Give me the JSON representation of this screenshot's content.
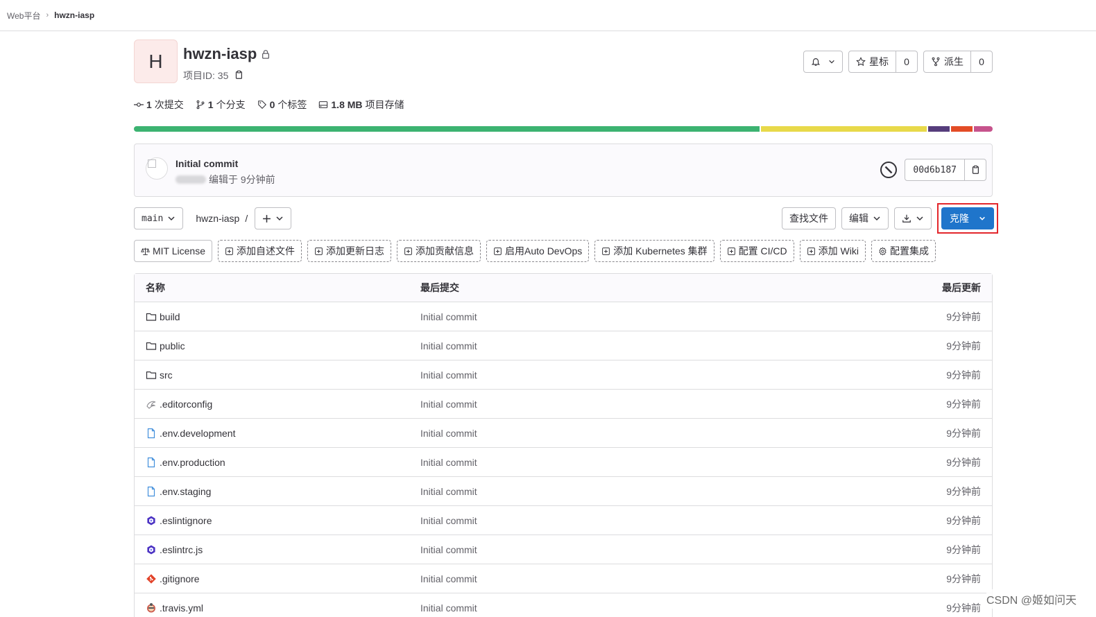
{
  "breadcrumb": {
    "group": "Web平台",
    "project": "hwzn-iasp"
  },
  "project": {
    "avatar_letter": "H",
    "name": "hwzn-iasp",
    "id_label": "项目ID: 35"
  },
  "actions": {
    "star_label": "星标",
    "star_count": "0",
    "fork_label": "派生",
    "fork_count": "0"
  },
  "stats": [
    {
      "icon": "commit-icon",
      "count": "1",
      "label": "次提交"
    },
    {
      "icon": "branch-icon",
      "count": "1",
      "label": "个分支"
    },
    {
      "icon": "tag-icon",
      "count": "0",
      "label": "个标签"
    },
    {
      "icon": "storage-icon",
      "count": "1.8 MB",
      "label": "项目存储"
    }
  ],
  "languages": [
    {
      "color": "#3cb371",
      "share": 0.733
    },
    {
      "color": "#e8d94a",
      "share": 0.195
    },
    {
      "color": "#563d7c",
      "share": 0.025
    },
    {
      "color": "#e34c26",
      "share": 0.025
    },
    {
      "color": "#c6538c",
      "share": 0.022
    }
  ],
  "last_commit": {
    "title": "Initial commit",
    "meta": "编辑于 9分钟前",
    "sha": "00d6b187"
  },
  "toolbar": {
    "branch": "main",
    "path": "hwzn-iasp",
    "path_sep": "/",
    "find_file": "查找文件",
    "edit": "编辑",
    "clone": "克隆"
  },
  "quicklinks": [
    {
      "label": "MIT License",
      "icon": "scale-icon",
      "style": "solid"
    },
    {
      "label": "添加自述文件",
      "icon": "plus-square-icon",
      "style": "dashed"
    },
    {
      "label": "添加更新日志",
      "icon": "plus-square-icon",
      "style": "dashed"
    },
    {
      "label": "添加贡献信息",
      "icon": "plus-square-icon",
      "style": "dashed"
    },
    {
      "label": "启用Auto DevOps",
      "icon": "plus-square-icon",
      "style": "dashed"
    },
    {
      "label": "添加 Kubernetes 集群",
      "icon": "plus-square-icon",
      "style": "dashed"
    },
    {
      "label": "配置 CI/CD",
      "icon": "plus-square-icon",
      "style": "dashed"
    },
    {
      "label": "添加 Wiki",
      "icon": "plus-square-icon",
      "style": "dashed"
    },
    {
      "label": "配置集成",
      "icon": "settings-icon",
      "style": "dashed"
    }
  ],
  "table": {
    "headers": {
      "name": "名称",
      "commit": "最后提交",
      "updated": "最后更新"
    },
    "rows": [
      {
        "name": "build",
        "icon": "folder-icon",
        "commit": "Initial commit",
        "updated": "9分钟前"
      },
      {
        "name": "public",
        "icon": "folder-icon",
        "commit": "Initial commit",
        "updated": "9分钟前"
      },
      {
        "name": "src",
        "icon": "folder-icon",
        "commit": "Initial commit",
        "updated": "9分钟前"
      },
      {
        "name": ".editorconfig",
        "icon": "editorconfig-icon",
        "commit": "Initial commit",
        "updated": "9分钟前"
      },
      {
        "name": ".env.development",
        "icon": "file-icon",
        "commit": "Initial commit",
        "updated": "9分钟前"
      },
      {
        "name": ".env.production",
        "icon": "file-icon",
        "commit": "Initial commit",
        "updated": "9分钟前"
      },
      {
        "name": ".env.staging",
        "icon": "file-icon",
        "commit": "Initial commit",
        "updated": "9分钟前"
      },
      {
        "name": ".eslintignore",
        "icon": "eslint-icon",
        "commit": "Initial commit",
        "updated": "9分钟前"
      },
      {
        "name": ".eslintrc.js",
        "icon": "eslint-icon",
        "commit": "Initial commit",
        "updated": "9分钟前"
      },
      {
        "name": ".gitignore",
        "icon": "git-icon",
        "commit": "Initial commit",
        "updated": "9分钟前"
      },
      {
        "name": ".travis.yml",
        "icon": "travis-icon",
        "commit": "Initial commit",
        "updated": "9分钟前"
      }
    ]
  },
  "watermark": "CSDN @姬如问天"
}
